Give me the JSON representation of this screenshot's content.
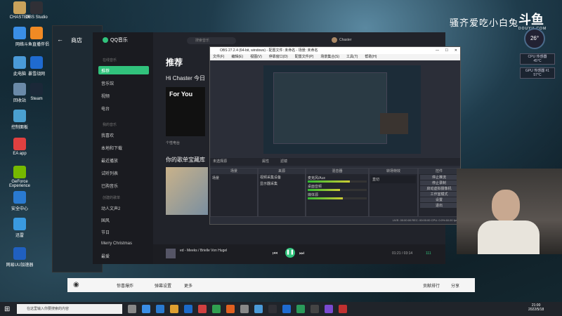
{
  "desktop": {
    "icons": [
      {
        "label": "CHASTER",
        "color": "#c9a25b"
      },
      {
        "label": "OBS Studio",
        "color": "#303036"
      },
      {
        "label": "网络",
        "color": "#3a8ee6"
      },
      {
        "label": "斗鱼直播伴侣",
        "color": "#f08a24"
      },
      {
        "label": "此电脑",
        "color": "#4a9ad8"
      },
      {
        "label": "暴雪战网",
        "color": "#1f6bd0"
      },
      {
        "label": "回收站",
        "color": "#6a8aa8"
      },
      {
        "label": "Steam",
        "color": "#1b2838"
      },
      {
        "label": "控制面板",
        "color": "#4aa0d0"
      },
      {
        "label": "EA app",
        "color": "#e04040"
      },
      {
        "label": "GeForce Experience",
        "color": "#76b900"
      },
      {
        "label": "安全中心",
        "color": "#2a7ad0"
      },
      {
        "label": "迅雷",
        "color": "#3a9ae0"
      },
      {
        "label": "网易UU加速器",
        "color": "#2060c0"
      }
    ]
  },
  "overlay": {
    "streamer_title": "骚齐爱吃小白兔",
    "logo": "斗鱼",
    "logo_sub": "DOUYU.COM",
    "temp": "26°",
    "cpu_label": "CPU 传感器",
    "cpu_value": "45°C",
    "gpu_label": "GPU 传感器 #1",
    "gpu_value": "57°C"
  },
  "store": {
    "title": "商店"
  },
  "qqmusic": {
    "app_name": "QQ音乐",
    "search_placeholder": "搜索音乐",
    "user_name": "Chaster",
    "heading": "推荐",
    "greeting": "Hi Chaster 今日",
    "section_playlist": "你的歌单宝藏库",
    "radio_label": "个性电台",
    "album_text": "For You",
    "nav_online": "在线音乐",
    "nav": [
      {
        "label": "推荐",
        "active": true
      },
      {
        "label": "音乐馆"
      },
      {
        "label": "视频"
      },
      {
        "label": "电台"
      }
    ],
    "nav_mine": "我的音乐",
    "nav2": [
      {
        "label": "我喜欢"
      },
      {
        "label": "本地和下载"
      },
      {
        "label": "最近播放"
      },
      {
        "label": "试听列表"
      },
      {
        "label": "已购音乐"
      }
    ],
    "nav_created": "创建的歌单",
    "playlists": [
      "动人文声2",
      "国风",
      "节日",
      "Merry Christmas",
      "最爱"
    ],
    "player": {
      "track": "ed - Meeks / Brielle Von Hugel",
      "time": "01:21 / 03:14",
      "count": "111"
    }
  },
  "obs": {
    "title": "OBS 27.2.4 (64-bit, windows) - 配置文件: 未命名 - 场景: 未命名",
    "menu": [
      "文件(F)",
      "编辑(E)",
      "视图(V)",
      "停靠窗口(D)",
      "配置文件(P)",
      "场景集合(S)",
      "工具(T)",
      "帮助(H)"
    ],
    "source_none": "未选择源",
    "prop_btn": "属性",
    "filter_btn": "滤镜",
    "docks": {
      "scenes": "场景",
      "sources": "来源",
      "mixer": "混音器",
      "transitions": "转场特效",
      "controls": "控件"
    },
    "scene_item": "场景",
    "sources": [
      "视频采集设备",
      "显示器采集"
    ],
    "mixer": [
      {
        "label": "麦克风/Aux",
        "level": 0.72
      },
      {
        "label": "桌面音频",
        "level": 0.55
      },
      {
        "label": "媒体源",
        "level": 0.6
      }
    ],
    "transition": "直切",
    "controls": [
      "停止推流",
      "停止录制",
      "启动虚拟摄像机",
      "工作室模式",
      "设置",
      "退出"
    ],
    "status": "LIVE: 00:00:00  REC: 00:00:00  CPU: 0.0%  60.00 fps"
  },
  "live": {
    "items": [
      "弹幕设置",
      "播放设置",
      "更多"
    ],
    "gift": "惊喜爆炸",
    "ranking": "贡献排行",
    "share": "分享"
  },
  "taskbar": {
    "search_placeholder": "在这里输入你要搜索的内容",
    "time": "21:00",
    "date": "2022/5/18"
  }
}
